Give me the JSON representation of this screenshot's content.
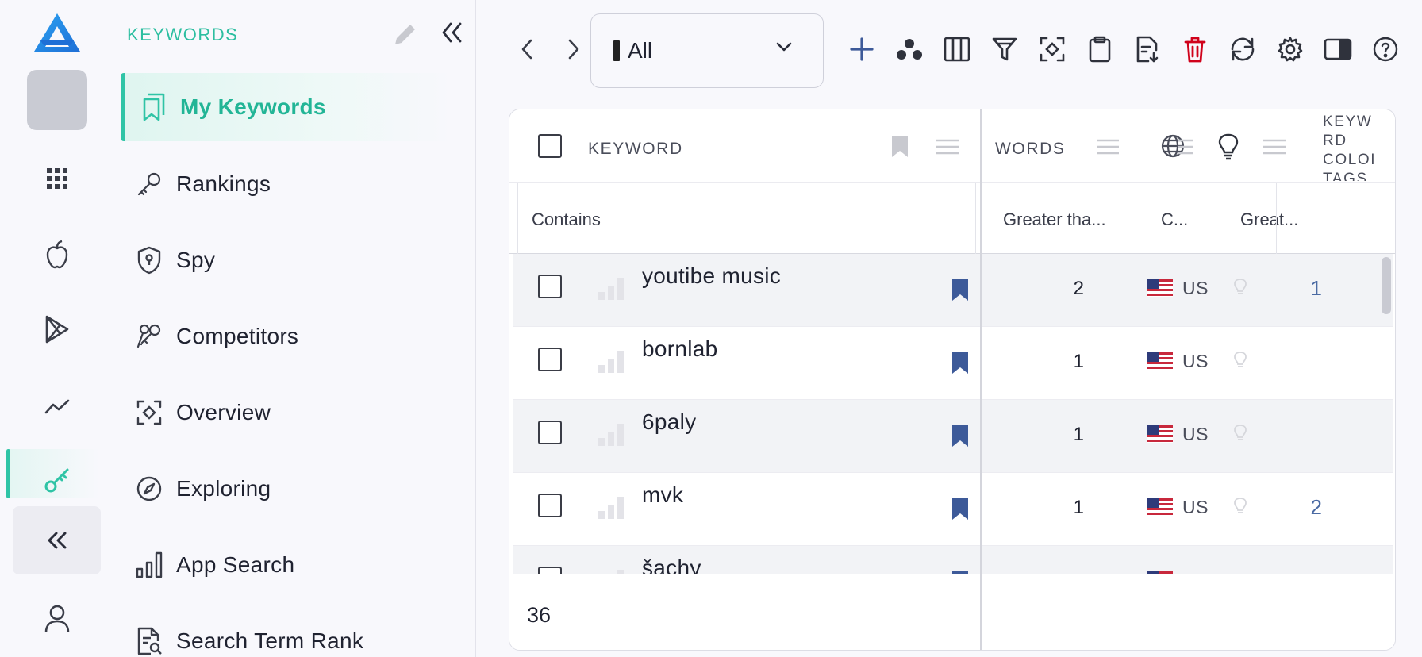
{
  "rail": {
    "logo": "appfigures-logo",
    "items": [
      {
        "name": "grid-icon"
      },
      {
        "name": "apple-icon"
      },
      {
        "name": "google-play-icon"
      },
      {
        "name": "trend-icon"
      },
      {
        "name": "key-icon",
        "active": true
      }
    ],
    "collapse": "double-chevron-left-icon",
    "profile": "user-icon"
  },
  "nav": {
    "title": "KEYWORDS",
    "items": [
      {
        "label": "My Keywords",
        "icon": "bookmarks-icon",
        "active": true
      },
      {
        "label": "Rankings",
        "icon": "key-icon"
      },
      {
        "label": "Spy",
        "icon": "shield-icon"
      },
      {
        "label": "Competitors",
        "icon": "keys-icon"
      },
      {
        "label": "Overview",
        "icon": "focus-icon"
      },
      {
        "label": "Exploring",
        "icon": "compass-icon"
      },
      {
        "label": "App Search",
        "icon": "bar-chart-icon"
      },
      {
        "label": "Search Term Rank",
        "icon": "document-search-icon"
      }
    ]
  },
  "toolbar": {
    "dropdown_value": "All",
    "buttons": [
      "back",
      "forward",
      "add",
      "group",
      "columns",
      "filter",
      "focus",
      "clipboard",
      "export",
      "delete",
      "refresh",
      "settings",
      "panel",
      "help"
    ]
  },
  "grid": {
    "headers": {
      "keyword": "KEYWORD",
      "words": "WORDS",
      "tags": "KEYWORD COLOR TAGS"
    },
    "filters": {
      "keyword": "Contains",
      "words": "Greater tha...",
      "country": "C...",
      "suggest": "Great..."
    },
    "rows": [
      {
        "keyword": "youtibe music",
        "words": "2",
        "country": "US",
        "suggest": "1"
      },
      {
        "keyword": "bornlab",
        "words": "1",
        "country": "US",
        "suggest": ""
      },
      {
        "keyword": "6paly",
        "words": "1",
        "country": "US",
        "suggest": ""
      },
      {
        "keyword": "mvk",
        "words": "1",
        "country": "US",
        "suggest": "2"
      },
      {
        "keyword": "šachy",
        "words": "",
        "country": "",
        "suggest": ""
      }
    ],
    "footer_count": "36"
  },
  "colors": {
    "accent": "#2fc4a6",
    "bookmark": "#3d5a99",
    "danger": "#d0021b",
    "link": "#4b6aa3"
  }
}
